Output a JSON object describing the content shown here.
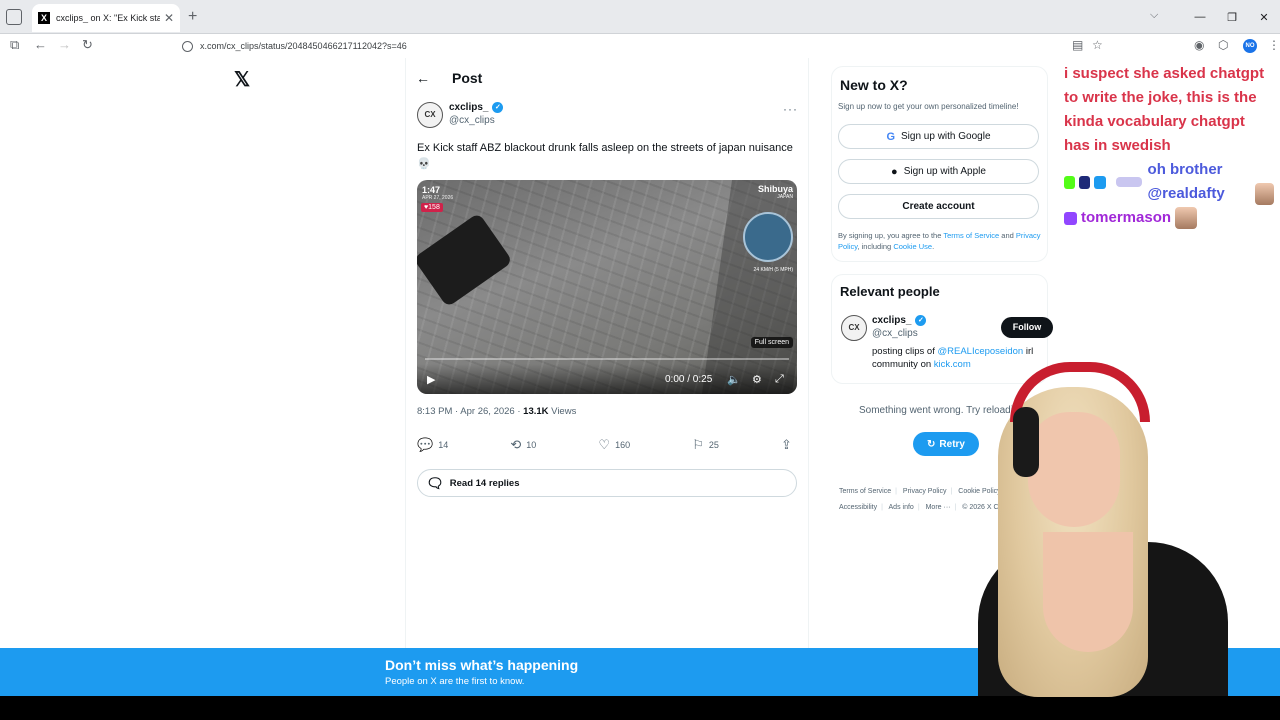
{
  "browser": {
    "tab_title": "cxclips_ on X: \"Ex Kick staff ABZ",
    "url": "x.com/cx_clips/status/2048450466217112042?s=46"
  },
  "page": {
    "header_title": "Post"
  },
  "tweet": {
    "display_name": "cxclips_",
    "handle": "@cx_clips",
    "avatar_text": "CX",
    "text": "Ex Kick staff ABZ blackout drunk falls asleep on the streets of japan nuisance 💀",
    "timestamp": "8:13 PM · Apr 26, 2026 · ",
    "views_count": "13.1K",
    "views_label": " Views",
    "replies": "14",
    "reposts": "10",
    "likes": "160",
    "bookmarks": "25",
    "read_replies": "Read 14 replies"
  },
  "video": {
    "overlay_time": "1:47",
    "overlay_date": "APR 27, 2026",
    "overlay_heart": "♥158",
    "overlay_location": "Shibuya",
    "overlay_country": "JAPAN",
    "overlay_speed": "24 KM/H (5 MPH)",
    "fullscreen_tip": "Full screen",
    "time": "0:00 / 0:25",
    "progress": 0
  },
  "sidebar": {
    "newx_title": "New to X?",
    "newx_sub": "Sign up now to get your own personalized timeline!",
    "google_btn": "Sign up with Google",
    "apple_btn": "Sign up with Apple",
    "create_btn": "Create account",
    "legal_1": "By signing up, you agree to the ",
    "terms": "Terms of Service",
    "legal_2": " and ",
    "privacy": "Privacy Policy",
    "legal_3": ", including ",
    "cookie": "Cookie Use",
    "legal_4": ".",
    "relevant_title": "Relevant people",
    "rp_name": "cxclips_",
    "rp_handle": "@cx_clips",
    "follow": "Follow",
    "bio_1": "posting clips of ",
    "bio_mention": "@REALIceposeidon",
    "bio_2": " irl community on ",
    "bio_link": "kick.com",
    "error": "Something went wrong. Try reloading.",
    "retry": "Retry",
    "footer": [
      "Terms of Service",
      "Privacy Policy",
      "Cookie Policy",
      "Accessibility",
      "Ads info",
      "More ···",
      "© 2026 X Corp."
    ]
  },
  "banner": {
    "title": "Don’t miss what’s happening",
    "sub": "People on X are the first to know."
  },
  "chat": {
    "message_1": "i suspect she asked chatgpt to write the joke, this is the kinda vocabulary chatgpt has in swedish",
    "message_2": "oh brother @realdafty",
    "message_3": "tomermason"
  },
  "colors": {
    "x_blue": "#1d9bf0",
    "chat_red": "#d9344a",
    "chat_blue": "#4c5adc",
    "chat_purple": "#a128d8"
  }
}
